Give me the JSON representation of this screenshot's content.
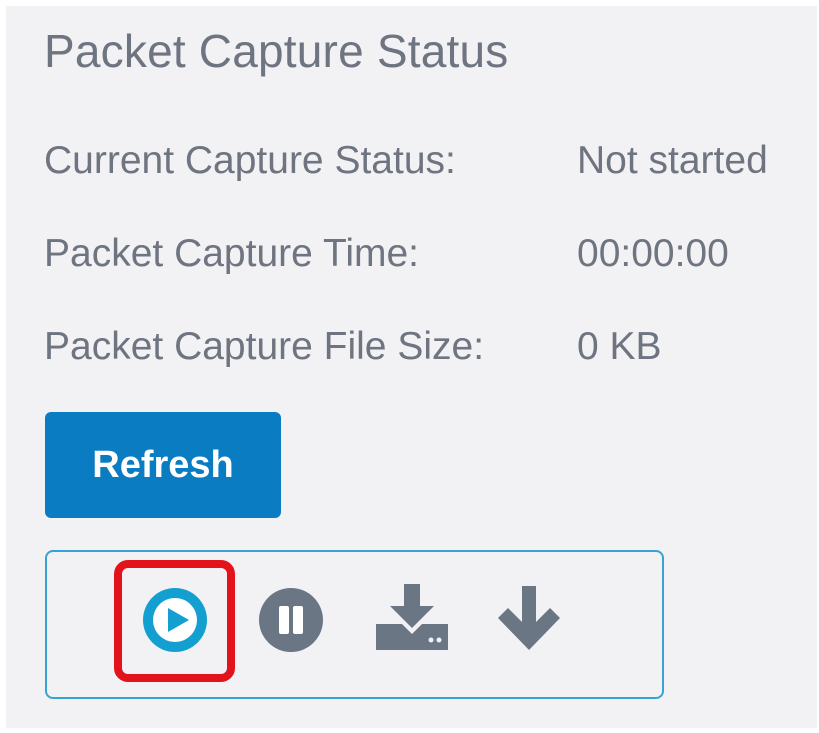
{
  "panel": {
    "title": "Packet Capture Status"
  },
  "status": {
    "rows": [
      {
        "label": "Current Capture Status:",
        "value": "Not started"
      },
      {
        "label": "Packet Capture Time:",
        "value": "00:00:00"
      },
      {
        "label": "Packet Capture File Size:",
        "value": "0 KB"
      }
    ]
  },
  "actions": {
    "refresh_label": "Refresh"
  },
  "controls": {
    "icons": [
      "play-icon",
      "pause-icon",
      "download-to-device-icon",
      "download-arrow-icon"
    ],
    "highlighted": "play-icon"
  },
  "colors": {
    "panel_bg": "#f2f2f5",
    "text": "#6e7480",
    "button_blue": "#0a7cc2",
    "box_border": "#36a3d4",
    "play_icon": "#149fd1",
    "control_gray": "#6b7685",
    "highlight_red": "#e3131b"
  }
}
